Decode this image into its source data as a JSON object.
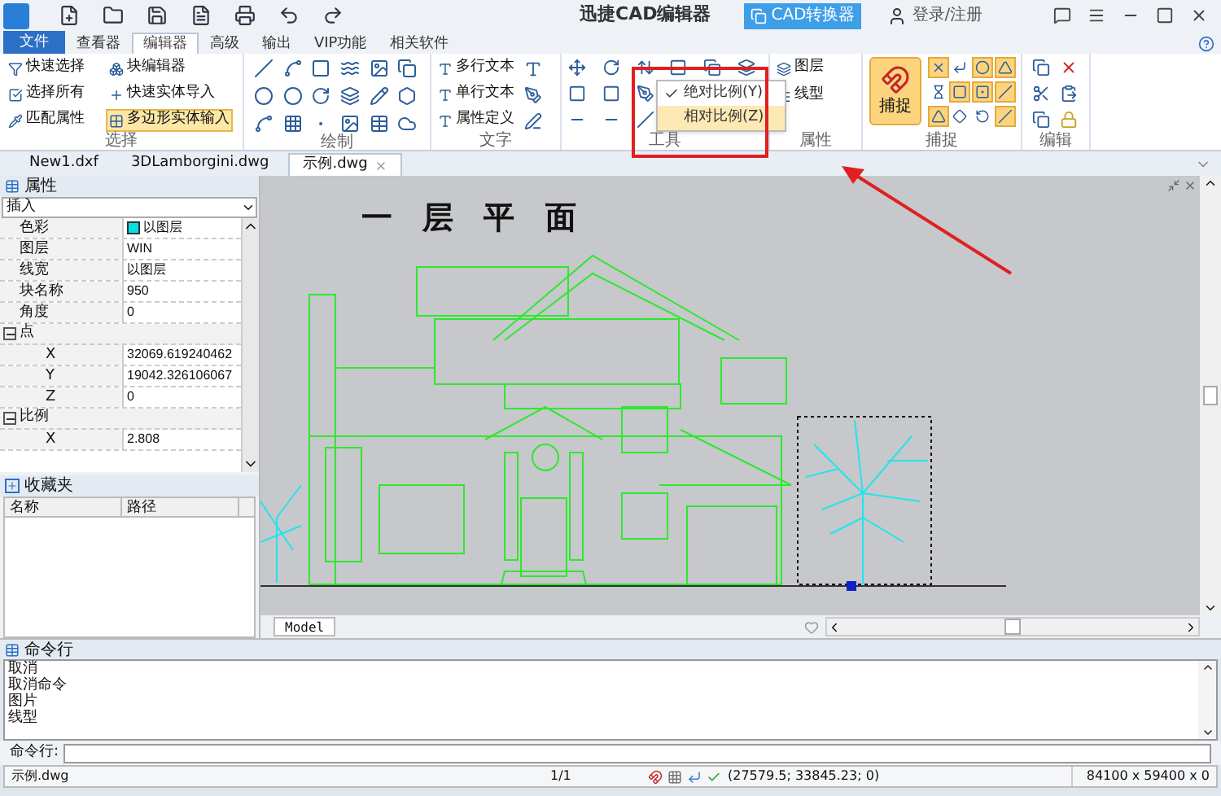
{
  "window": {
    "title": "迅捷CAD编辑器",
    "converter_button": "CAD转换器",
    "login": "登录/注册"
  },
  "ribbon_tabs": [
    {
      "label": "文件",
      "kind": "file",
      "selected": false
    },
    {
      "label": "查看器",
      "kind": "tab",
      "selected": false
    },
    {
      "label": "编辑器",
      "kind": "tab",
      "selected": true
    },
    {
      "label": "高级",
      "kind": "tab",
      "selected": false
    },
    {
      "label": "输出",
      "kind": "tab",
      "selected": false
    },
    {
      "label": "VIP功能",
      "kind": "tab",
      "selected": false
    },
    {
      "label": "相关软件",
      "kind": "tab",
      "selected": false
    }
  ],
  "select_group": {
    "title": "选择",
    "items": [
      {
        "label": "快速选择",
        "selected": false
      },
      {
        "label": "块编辑器",
        "selected": false
      },
      {
        "label": "选择所有",
        "selected": false
      },
      {
        "label": "快速实体导入",
        "selected": false
      },
      {
        "label": "匹配属性",
        "selected": false
      },
      {
        "label": "多边形实体输入",
        "selected": true
      }
    ]
  },
  "draw_group": {
    "title": "绘制"
  },
  "text_group": {
    "title": "文字",
    "items": [
      {
        "label": "多行文本"
      },
      {
        "label": "单行文本"
      },
      {
        "label": "属性定义"
      }
    ]
  },
  "tools_group": {
    "title": "工具",
    "menu": [
      {
        "label": "绝对比例(Y)",
        "checked": true,
        "highlighted": false
      },
      {
        "label": "相对比例(Z)",
        "checked": false,
        "highlighted": true
      }
    ]
  },
  "properties_group": {
    "title": "属性",
    "items": [
      {
        "label": "图层"
      },
      {
        "label": "线型"
      }
    ]
  },
  "snap_group": {
    "title": "捕捉",
    "button": {
      "label": "捕捉",
      "selected": true
    },
    "modes": [
      {
        "on": true
      },
      {
        "on": false
      },
      {
        "on": true
      },
      {
        "on": true
      },
      {
        "on": false
      },
      {
        "on": true
      },
      {
        "on": true
      },
      {
        "on": true
      },
      {
        "on": true
      },
      {
        "on": false
      },
      {
        "on": false
      },
      {
        "on": true
      }
    ]
  },
  "edit_group": {
    "title": "编辑"
  },
  "document_tabs": [
    {
      "label": "New1.dxf",
      "selected": false
    },
    {
      "label": "3DLamborgini.dwg",
      "selected": false
    },
    {
      "label": "示例.dwg",
      "selected": true
    }
  ],
  "properties_panel": {
    "title": "属性",
    "object_type": "插入",
    "rows": [
      {
        "kind": "row",
        "label": "色彩",
        "value": "以图层",
        "color": "#00e0e0"
      },
      {
        "kind": "row",
        "label": "图层",
        "value": "WIN"
      },
      {
        "kind": "row",
        "label": "线宽",
        "value": "以图层"
      },
      {
        "kind": "row",
        "label": "块名称",
        "value": "950"
      },
      {
        "kind": "row",
        "label": "角度",
        "value": "0"
      },
      {
        "kind": "section",
        "label": "点",
        "expanded": true
      },
      {
        "kind": "row",
        "label": "X",
        "value": "32069.619240462"
      },
      {
        "kind": "row",
        "label": "Y",
        "value": "19042.326106067"
      },
      {
        "kind": "row",
        "label": "Z",
        "value": "0"
      },
      {
        "kind": "section",
        "label": "比例",
        "expanded": true
      },
      {
        "kind": "row",
        "label": "X",
        "value": "2.808"
      }
    ]
  },
  "favorites_panel": {
    "title": "收藏夹",
    "columns": [
      "名称",
      "路径"
    ]
  },
  "drawing": {
    "title": "一 层 平 面",
    "layout_tab": "Model"
  },
  "command_panel": {
    "title": "命令行",
    "history": [
      "取消",
      "取消命令",
      "图片",
      "线型"
    ],
    "input_label": "命令行:"
  },
  "status_bar": {
    "file": "示例.dwg",
    "page": "1/1",
    "coordinates": "(27579.5; 33845.23; 0)",
    "extents": "84100 x 59400 x 0"
  }
}
